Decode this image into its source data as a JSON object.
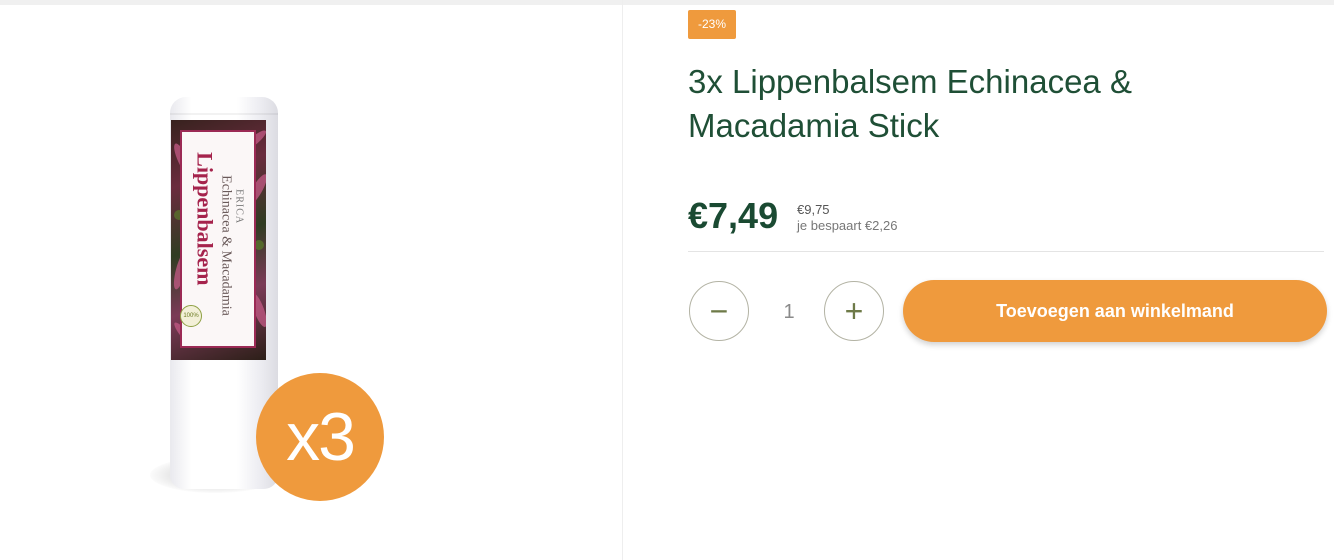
{
  "product": {
    "discount_badge": "-23%",
    "title": "3x Lippenbalsem Echinacea & Macadamia Stick",
    "price": "€7,49",
    "old_price": "€9,75",
    "savings": "je bespaart €2,26",
    "image": {
      "label_brand": "ERICA",
      "label_line1": "Echinacea & Macadamia",
      "label_line2": "Lippenbalsem",
      "bio_seal": "100%",
      "multiplier_badge": "x3"
    }
  },
  "cart": {
    "decrease_icon": "minus-icon",
    "increase_icon": "plus-icon",
    "decrease_symbol": "−",
    "increase_symbol": "+",
    "quantity": "1",
    "add_to_cart_label": "Toevoegen aan winkelmand"
  },
  "colors": {
    "accent": "#ef9a3d",
    "title_green": "#1f4f36",
    "price_green": "#1a4a32"
  }
}
